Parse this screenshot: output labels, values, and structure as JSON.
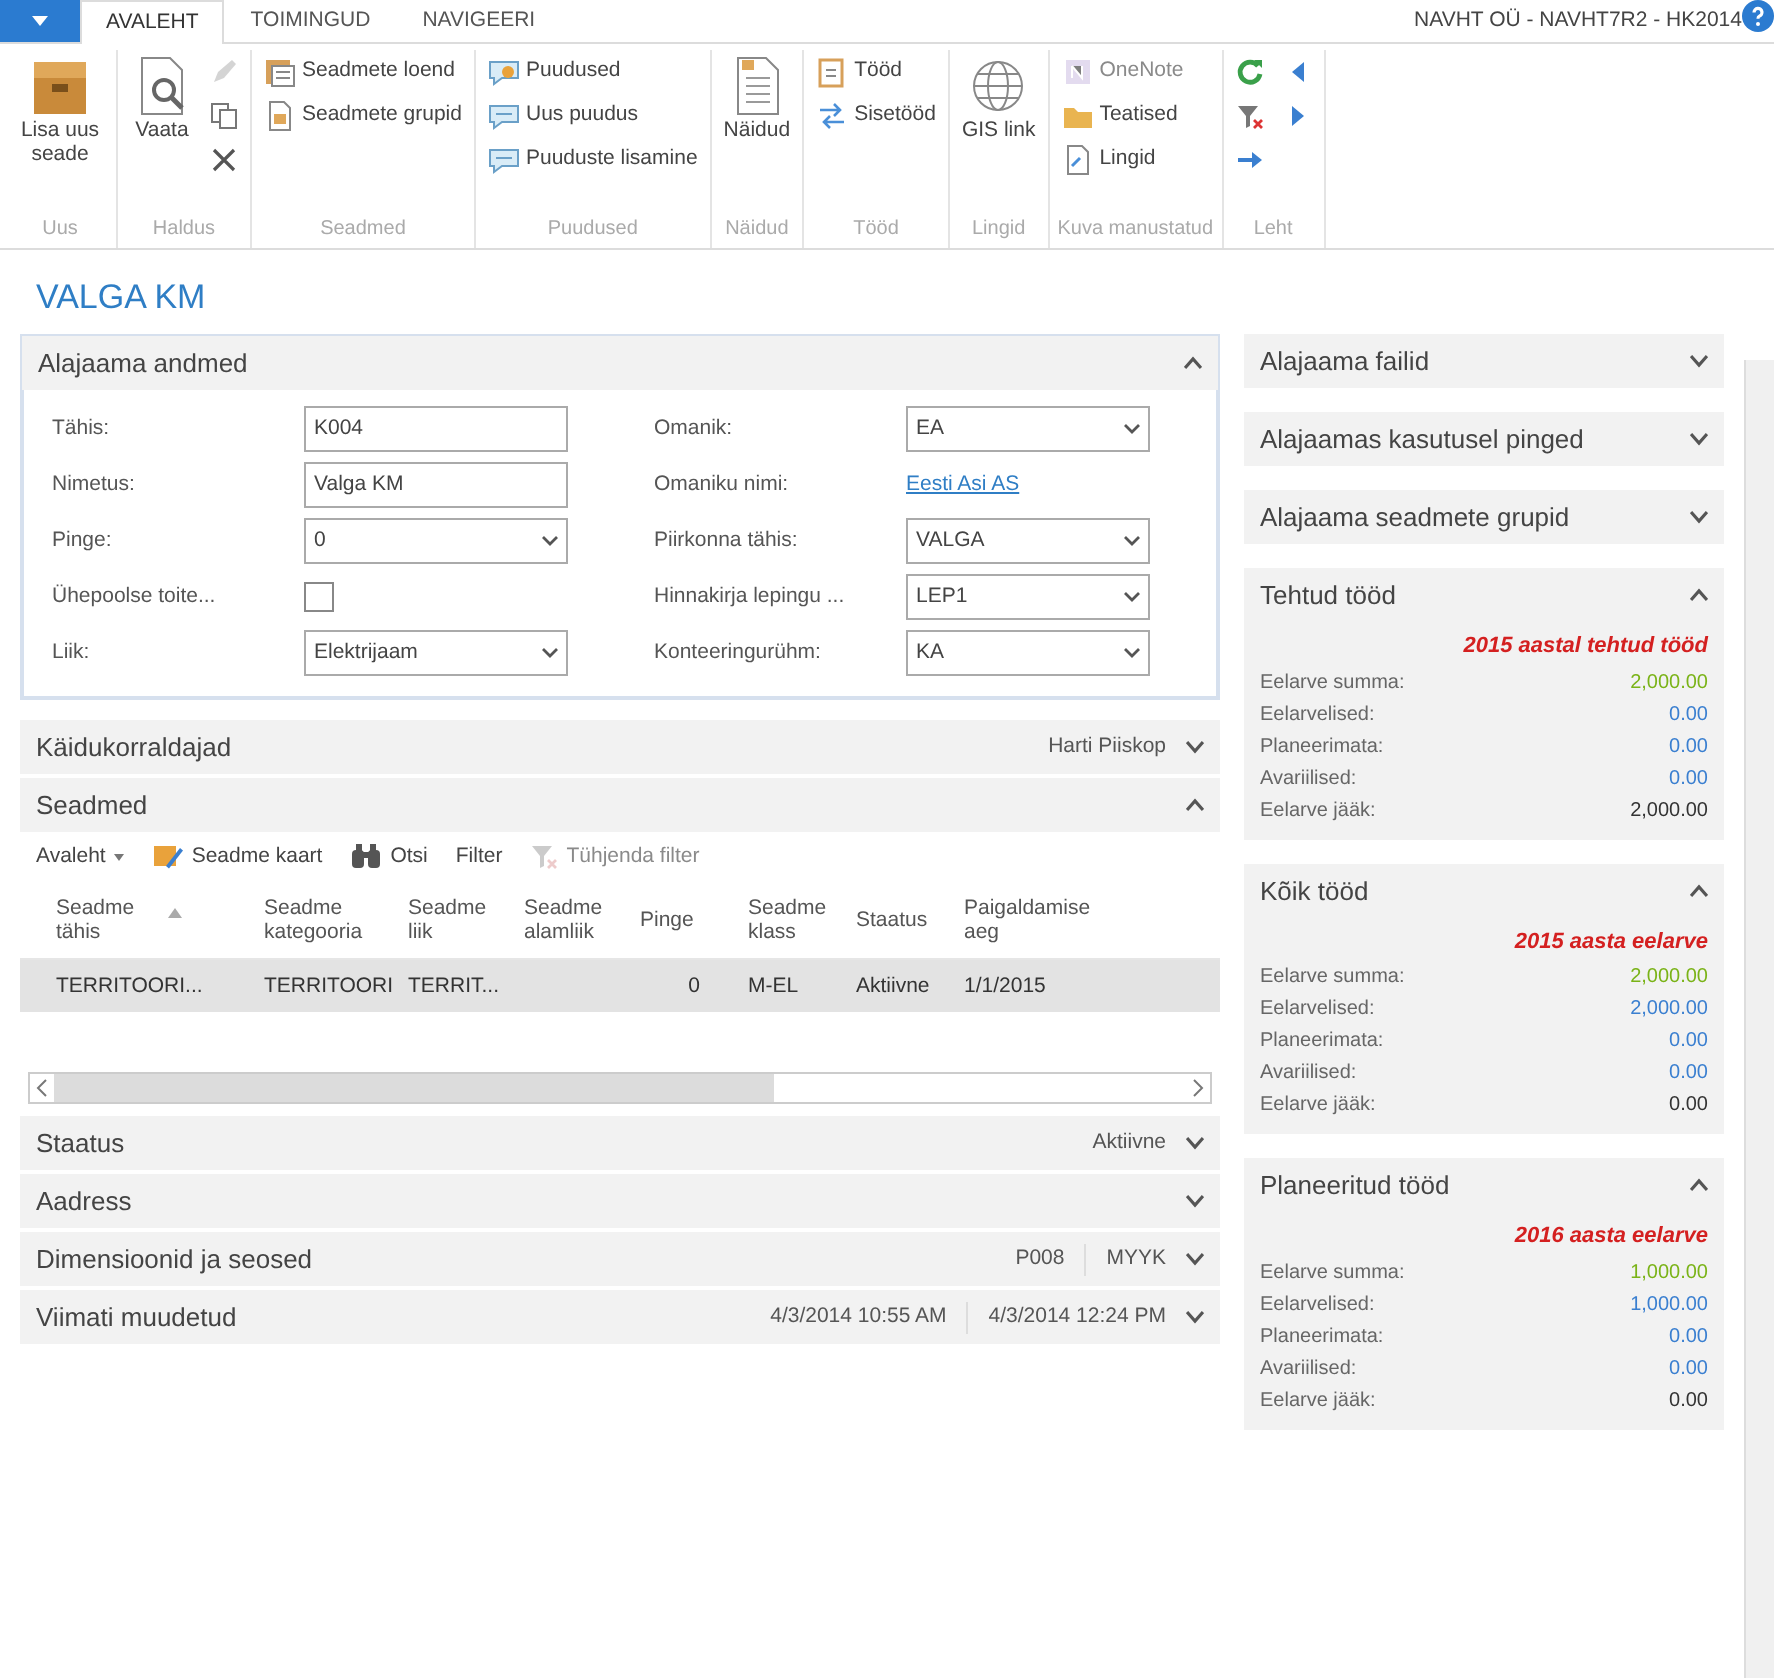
{
  "tabs": [
    {
      "label": "AVALEHT",
      "selected": true
    },
    {
      "label": "TOIMINGUD",
      "selected": false
    },
    {
      "label": "NAVIGEERI",
      "selected": false
    }
  ],
  "company": "NAVHT OÜ - NAVHT7R2 - HK2014",
  "ribbon": [
    {
      "label": "Uus",
      "items": [
        {
          "kind": "large",
          "label": "Lisa uus seade",
          "disabled": false
        }
      ]
    },
    {
      "label": "Haldus",
      "items": [
        {
          "kind": "large",
          "label": "Vaata",
          "disabled": false
        },
        {
          "kind": "icon",
          "disabled": true
        },
        {
          "kind": "icon",
          "disabled": false
        },
        {
          "kind": "icon",
          "disabled": false
        }
      ]
    },
    {
      "label": "Seadmed",
      "items": [
        {
          "kind": "small",
          "label": "Seadmete loend",
          "disabled": false
        },
        {
          "kind": "small",
          "label": "Seadmete grupid",
          "disabled": false
        }
      ]
    },
    {
      "label": "Puudused",
      "items": [
        {
          "kind": "small",
          "label": "Puudused",
          "disabled": false
        },
        {
          "kind": "small",
          "label": "Uus puudus",
          "disabled": false
        },
        {
          "kind": "small",
          "label": "Puuduste lisamine",
          "disabled": false
        }
      ]
    },
    {
      "label": "Näidud",
      "items": [
        {
          "kind": "large",
          "label": "Näidud",
          "disabled": false
        }
      ]
    },
    {
      "label": "Tööd",
      "items": [
        {
          "kind": "small",
          "label": "Tööd",
          "disabled": false
        },
        {
          "kind": "small",
          "label": "Sisetööd",
          "disabled": false
        }
      ]
    },
    {
      "label": "Lingid",
      "items": [
        {
          "kind": "large",
          "label": "GIS link",
          "disabled": false
        }
      ]
    },
    {
      "label": "Kuva manustatud",
      "items": [
        {
          "kind": "small",
          "label": "OneNote",
          "disabled": true
        },
        {
          "kind": "small",
          "label": "Teatised",
          "disabled": false
        },
        {
          "kind": "small",
          "label": "Lingid",
          "disabled": false
        }
      ]
    },
    {
      "label": "Leht",
      "items": [
        {
          "kind": "icon",
          "disabled": false
        },
        {
          "kind": "icon",
          "disabled": false
        },
        {
          "kind": "icon",
          "disabled": false
        },
        {
          "kind": "icon",
          "disabled": false
        },
        {
          "kind": "icon",
          "disabled": false
        }
      ]
    }
  ],
  "page_title": "VALGA KM",
  "sections": [
    {
      "kind": "fields",
      "title": "Alajaama andmed",
      "expanded": true,
      "fields_left": [
        {
          "label": "Tähis:",
          "kind": "text",
          "value": "K004"
        },
        {
          "label": "Nimetus:",
          "kind": "text",
          "value": "Valga KM"
        },
        {
          "label": "Pinge:",
          "kind": "select",
          "value": "0"
        },
        {
          "label": "Ühepoolse toite...",
          "kind": "checkbox",
          "checked": false
        },
        {
          "label": "Liik:",
          "kind": "select",
          "value": "Elektrijaam"
        }
      ],
      "fields_right": [
        {
          "label": "Omanik:",
          "kind": "select",
          "value": "EA"
        },
        {
          "label": "Omaniku nimi:",
          "kind": "link",
          "value": "Eesti Asi AS"
        },
        {
          "label": "Piirkonna tähis:",
          "kind": "select",
          "value": "VALGA"
        },
        {
          "label": "Hinnakirja lepingu ...",
          "kind": "select",
          "value": "LEP1"
        },
        {
          "label": "Konteeringurühm:",
          "kind": "select",
          "value": "KA"
        }
      ]
    },
    {
      "kind": "summary",
      "title": "Käidukorraldajad",
      "expanded": false,
      "summary": [
        "Harti Piiskop"
      ]
    },
    {
      "kind": "table",
      "title": "Seadmed",
      "expanded": true,
      "toolbar": [
        {
          "label": "Avaleht",
          "kind": "menu",
          "disabled": false
        },
        {
          "label": "Seadme kaart",
          "kind": "button",
          "disabled": false
        },
        {
          "label": "Otsi",
          "kind": "button",
          "disabled": false
        },
        {
          "label": "Filter",
          "kind": "button",
          "disabled": false
        },
        {
          "label": "Tühjenda filter",
          "kind": "button",
          "disabled": true
        }
      ],
      "columns": [
        {
          "label": "Seadme tähis",
          "sorted": true
        },
        {
          "label": "Seadme kategooria",
          "sorted": false
        },
        {
          "label": "Seadme liik",
          "sorted": false
        },
        {
          "label": "Seadme alamliik",
          "sorted": false
        },
        {
          "label": "Pinge",
          "sorted": false
        },
        {
          "label": "Seadme klass",
          "sorted": false
        },
        {
          "label": "Staatus",
          "sorted": false
        },
        {
          "label": "Paigaldamise aeg",
          "sorted": false
        }
      ],
      "rows": [
        {
          "selected": true,
          "cells": [
            "TERRITOORI...",
            "TERRITOORI",
            "TERRIT...",
            "",
            "0",
            "M-EL",
            "Aktiivne",
            "1/1/2015"
          ]
        }
      ]
    },
    {
      "kind": "summary",
      "title": "Staatus",
      "expanded": false,
      "summary": [
        "Aktiivne"
      ]
    },
    {
      "kind": "summary",
      "title": "Aadress",
      "expanded": false
    },
    {
      "kind": "summary",
      "title": "Dimensioonid ja seosed",
      "expanded": false,
      "summary": [
        "P008",
        "MYYK"
      ]
    },
    {
      "kind": "summary",
      "title": "Viimati muudetud",
      "expanded": false,
      "summary": [
        "4/3/2014 10:55 AM",
        "4/3/2014 12:24 PM"
      ]
    }
  ],
  "factboxes": [
    {
      "title": "Alajaama failid",
      "expanded": false
    },
    {
      "title": "Alajaamas kasutusel pinged",
      "expanded": false
    },
    {
      "title": "Alajaama seadmete grupid",
      "expanded": false
    },
    {
      "title": "Tehtud tööd",
      "expanded": true,
      "subtitle": "2015 aastal tehtud tööd",
      "rows": [
        {
          "label": "Eelarve summa:",
          "value": "2,000.00",
          "color": "#7ab317"
        },
        {
          "label": "Eelarvelised:",
          "value": "0.00",
          "color": "#3a7fd0"
        },
        {
          "label": "Planeerimata:",
          "value": "0.00",
          "color": "#3a7fd0"
        },
        {
          "label": "Avariilised:",
          "value": "0.00",
          "color": "#3a7fd0"
        },
        {
          "label": "Eelarve jääk:",
          "value": "2,000.00",
          "color": "#333333"
        }
      ]
    },
    {
      "title": "Kõik tööd",
      "expanded": true,
      "subtitle": "2015 aasta eelarve",
      "rows": [
        {
          "label": "Eelarve summa:",
          "value": "2,000.00",
          "color": "#7ab317"
        },
        {
          "label": "Eelarvelised:",
          "value": "2,000.00",
          "color": "#3a7fd0"
        },
        {
          "label": "Planeerimata:",
          "value": "0.00",
          "color": "#3a7fd0"
        },
        {
          "label": "Avariilised:",
          "value": "0.00",
          "color": "#3a7fd0"
        },
        {
          "label": "Eelarve jääk:",
          "value": "0.00",
          "color": "#333333"
        }
      ]
    },
    {
      "title": "Planeeritud tööd",
      "expanded": true,
      "subtitle": "2016 aasta eelarve",
      "rows": [
        {
          "label": "Eelarve summa:",
          "value": "1,000.00",
          "color": "#7ab317"
        },
        {
          "label": "Eelarvelised:",
          "value": "1,000.00",
          "color": "#3a7fd0"
        },
        {
          "label": "Planeerimata:",
          "value": "0.00",
          "color": "#3a7fd0"
        },
        {
          "label": "Avariilised:",
          "value": "0.00",
          "color": "#3a7fd0"
        },
        {
          "label": "Eelarve jääk:",
          "value": "0.00",
          "color": "#333333"
        }
      ]
    }
  ]
}
